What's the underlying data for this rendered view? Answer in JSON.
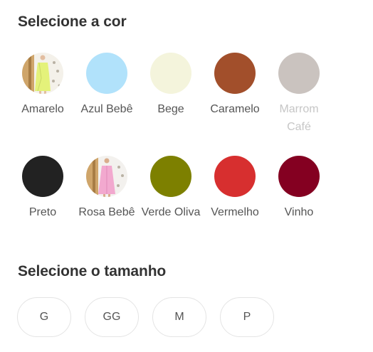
{
  "color_section": {
    "title": "Selecione a cor",
    "colors": [
      {
        "label": "Amarelo",
        "swatch": "photo-yellow-dress",
        "hex": "#e9f08c",
        "available": true
      },
      {
        "label": "Azul Bebê",
        "swatch": "solid",
        "hex": "#b1e2fb",
        "available": true
      },
      {
        "label": "Bege",
        "swatch": "solid",
        "hex": "#f4f4dc",
        "available": true
      },
      {
        "label": "Caramelo",
        "swatch": "solid",
        "hex": "#a24f2b",
        "available": true
      },
      {
        "label": "Marrom Café",
        "swatch": "solid",
        "hex": "#cac3bf",
        "available": false
      },
      {
        "label": "Preto",
        "swatch": "solid",
        "hex": "#222222",
        "available": true
      },
      {
        "label": "Rosa Bebê",
        "swatch": "photo-pink-dress",
        "hex": "#f2a9cf",
        "available": true
      },
      {
        "label": "Verde Oliva",
        "swatch": "solid",
        "hex": "#7d8000",
        "available": true
      },
      {
        "label": "Vermelho",
        "swatch": "solid",
        "hex": "#d72f2f",
        "available": true
      },
      {
        "label": "Vinho",
        "swatch": "solid",
        "hex": "#840021",
        "available": true
      }
    ]
  },
  "size_section": {
    "title": "Selecione o tamanho",
    "sizes": [
      "G",
      "GG",
      "M",
      "P"
    ]
  }
}
